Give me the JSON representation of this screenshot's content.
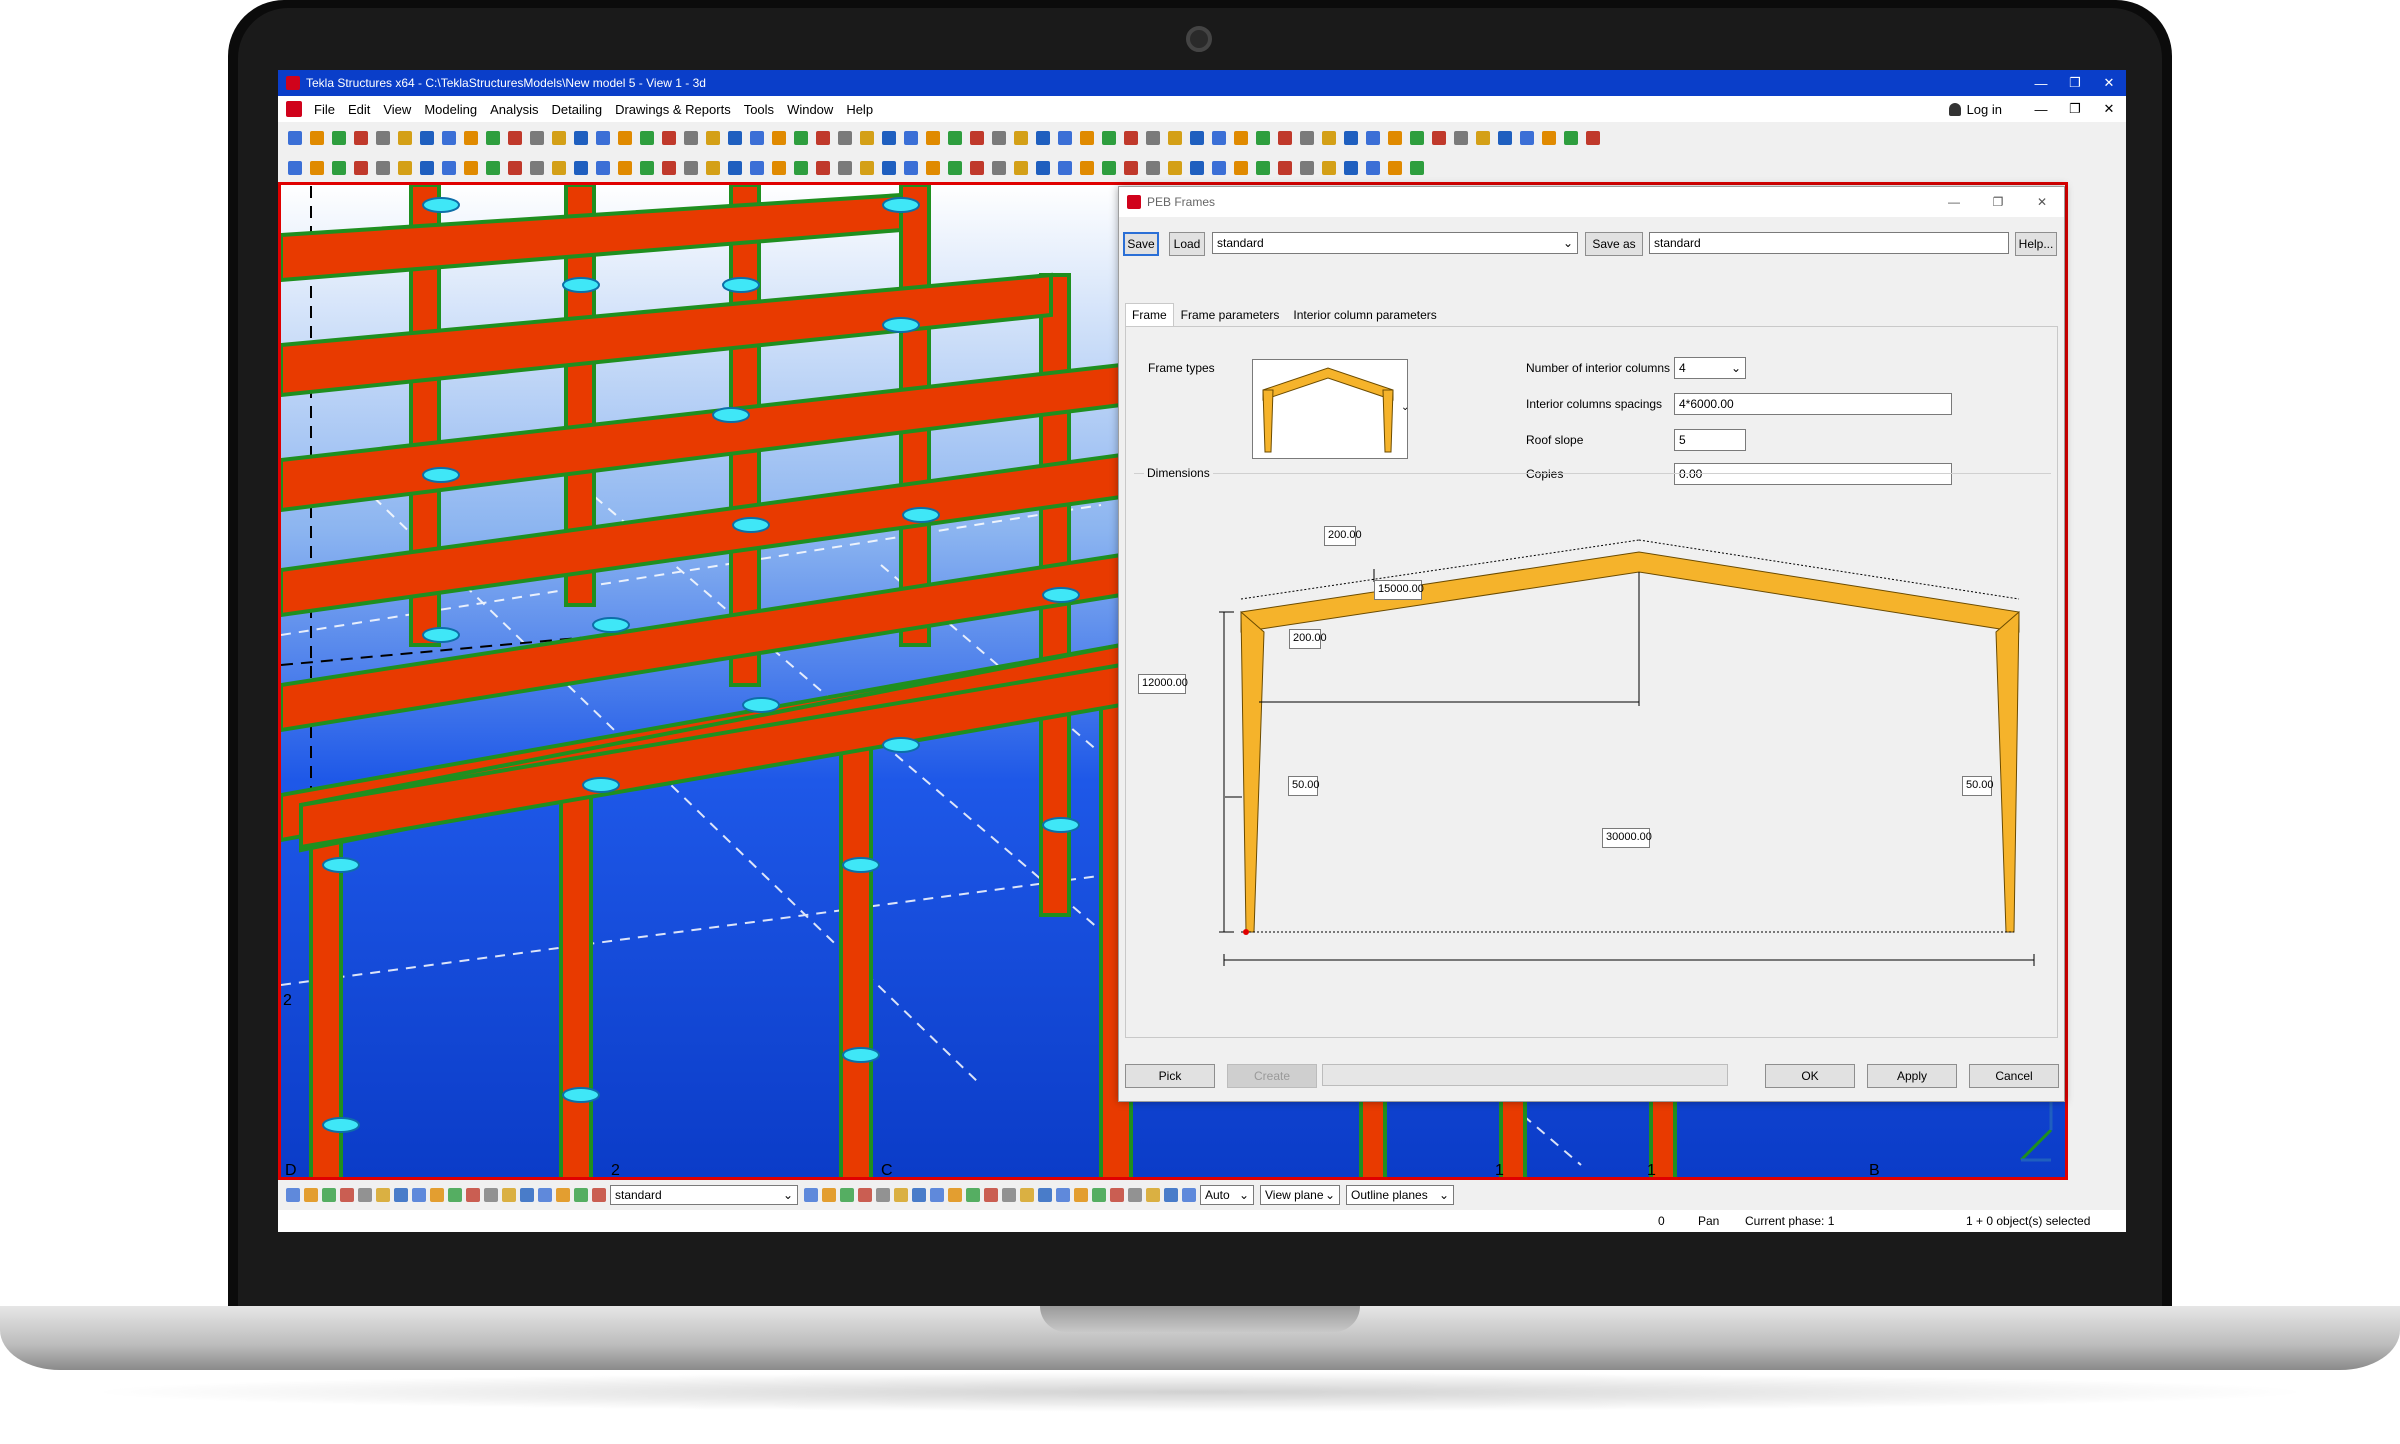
{
  "window": {
    "title": "Tekla Structures x64 - C:\\TeklaStructuresModels\\New model 5 - View 1 - 3d",
    "minimize_glyph": "—",
    "maximize_glyph": "❐",
    "close_glyph": "✕"
  },
  "menu": {
    "items": [
      "File",
      "Edit",
      "View",
      "Modeling",
      "Analysis",
      "Detailing",
      "Drawings & Reports",
      "Tools",
      "Window",
      "Help"
    ],
    "login_label": "Log in"
  },
  "viewport": {
    "grid_labels": [
      "2",
      "D",
      "2",
      "C",
      "1",
      "1",
      "B"
    ]
  },
  "dialog": {
    "title": "PEB Frames",
    "save_label": "Save",
    "load_label": "Load",
    "attribute_file": "standard",
    "save_as_label": "Save as",
    "save_as_value": "standard",
    "help_label": "Help...",
    "tabs": [
      "Frame",
      "Frame parameters",
      "Interior column parameters"
    ],
    "frame_types_label": "Frame types",
    "num_interior_columns_label": "Number of interior columns",
    "num_interior_columns_value": "4",
    "interior_spacings_label": "Interior columns spacings",
    "interior_spacings_value": "4*6000.00",
    "roof_slope_label": "Roof slope",
    "roof_slope_value": "5",
    "copies_label": "Copies",
    "copies_value": "0.00",
    "dimensions_label": "Dimensions",
    "dims": {
      "top_depth": "200.00",
      "half_span": "15000.00",
      "column_depth": "200.00",
      "height": "12000.00",
      "base_left": "50.00",
      "base_right": "50.00",
      "span": "30000.00"
    },
    "pick_label": "Pick",
    "create_label": "Create",
    "ok_label": "OK",
    "apply_label": "Apply",
    "cancel_label": "Cancel"
  },
  "bottom_toolbar": {
    "filter_value": "standard",
    "snap_mode": "Auto",
    "plane_mode": "View plane",
    "outline_mode": "Outline planes"
  },
  "status": {
    "count": "0",
    "mode": "Pan",
    "phase": "Current phase: 1",
    "selection": "1 + 0 object(s) selected"
  },
  "colors": {
    "titlebar": "#0a3ec9",
    "viewport_border": "#e00000",
    "beam": "#e83a00",
    "beam_edge": "#1f8f1f",
    "frame_member": "#f5b32b"
  }
}
